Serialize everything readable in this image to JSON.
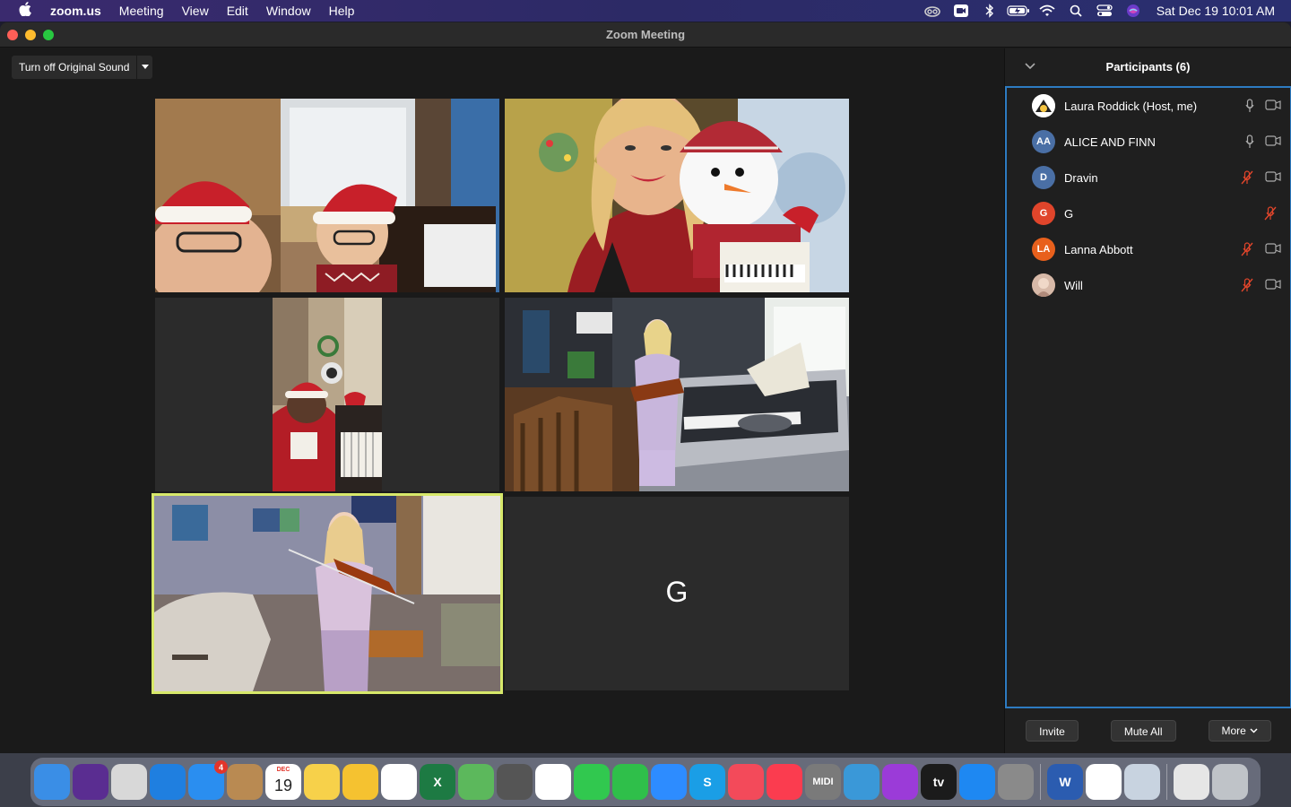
{
  "menubar": {
    "apple_icon": "apple-logo",
    "app_name": "zoom.us",
    "menus": [
      "Meeting",
      "View",
      "Edit",
      "Window",
      "Help"
    ],
    "clock": "Sat Dec 19  10:01 AM",
    "status_icons": [
      "creative-cloud-icon",
      "zoom-icon",
      "bluetooth-icon",
      "battery-icon",
      "wifi-icon",
      "spotlight-icon",
      "control-center-icon",
      "siri-icon"
    ]
  },
  "window": {
    "title": "Zoom Meeting"
  },
  "meeting": {
    "original_sound_label": "Turn off Original Sound",
    "tiles": [
      {
        "participant": "Laura Roddick",
        "active_speaker": false
      },
      {
        "participant": "ALICE AND FINN",
        "active_speaker": false
      },
      {
        "participant": "Dravin",
        "active_speaker": false
      },
      {
        "participant": "Lanna Abbott",
        "active_speaker": false
      },
      {
        "participant": "Will",
        "active_speaker": true
      },
      {
        "participant": "G",
        "active_speaker": false,
        "placeholder_text": "G"
      }
    ],
    "active_speaker_color": "#d7e86a"
  },
  "participants": {
    "header": "Participants (6)",
    "list": [
      {
        "name": "Laura Roddick (Host, me)",
        "initials": "",
        "avatar_color": "#ffffff",
        "mic": "on",
        "video": "on"
      },
      {
        "name": "ALICE AND FINN",
        "initials": "AA",
        "avatar_color": "#4a6fa5",
        "mic": "on",
        "video": "on"
      },
      {
        "name": "Dravin",
        "initials": "D",
        "avatar_color": "#4a6fa5",
        "mic": "muted",
        "video": "on"
      },
      {
        "name": "G",
        "initials": "G",
        "avatar_color": "#e0452b",
        "mic": "muted",
        "video": "none"
      },
      {
        "name": "Lanna Abbott",
        "initials": "LA",
        "avatar_color": "#e8601c",
        "mic": "muted",
        "video": "on"
      },
      {
        "name": "Will",
        "initials": "",
        "avatar_color": "#c9a08a",
        "mic": "muted",
        "video": "on"
      }
    ],
    "buttons": {
      "invite": "Invite",
      "mute_all": "Mute All",
      "more": "More"
    },
    "highlight_color": "#2d7bc1",
    "muted_color": "#e0452b"
  },
  "dock": {
    "apps": [
      {
        "name": "finder-icon",
        "color": "#3a8ee6"
      },
      {
        "name": "siri-icon",
        "color": "#5a2d91"
      },
      {
        "name": "launchpad-icon",
        "color": "#d8d8d8"
      },
      {
        "name": "safari-icon",
        "color": "#1f7fe0"
      },
      {
        "name": "mail-icon",
        "color": "#2a8ef0",
        "badge": "4"
      },
      {
        "name": "contacts-icon",
        "color": "#b98a52"
      },
      {
        "name": "calendar-icon",
        "color": "#ffffff",
        "month": "DEC",
        "day": "19"
      },
      {
        "name": "notes-icon",
        "color": "#f7d14a"
      },
      {
        "name": "weather-icon",
        "color": "#f5c230"
      },
      {
        "name": "reminders-icon",
        "color": "#ffffff"
      },
      {
        "name": "excel-icon",
        "color": "#1d7a43",
        "letter": "X"
      },
      {
        "name": "maps-icon",
        "color": "#5cb85c"
      },
      {
        "name": "calculator-icon",
        "color": "#555555"
      },
      {
        "name": "photos-icon",
        "color": "#ffffff"
      },
      {
        "name": "messages-icon",
        "color": "#31c84f"
      },
      {
        "name": "facetime-icon",
        "color": "#2fbf4a"
      },
      {
        "name": "zoom-icon",
        "color": "#2d8cff"
      },
      {
        "name": "skype-icon",
        "color": "#1a9ee6",
        "letter": "S"
      },
      {
        "name": "news-icon",
        "color": "#f34a5a"
      },
      {
        "name": "music-icon",
        "color": "#fb3c4f"
      },
      {
        "name": "midi-icon",
        "color": "#7a7a7a",
        "letter": "MIDI"
      },
      {
        "name": "simplenote-icon",
        "color": "#3a98d8"
      },
      {
        "name": "podcasts-icon",
        "color": "#9b3bd8"
      },
      {
        "name": "appletv-icon",
        "color": "#1b1b1b",
        "letter": "tv"
      },
      {
        "name": "appstore-icon",
        "color": "#1e88f2"
      },
      {
        "name": "system-preferences-icon",
        "color": "#8a8a8a"
      },
      {
        "name": "word-icon",
        "color": "#2b5cb0",
        "letter": "W"
      },
      {
        "name": "chrome-icon",
        "color": "#ffffff"
      },
      {
        "name": "preview-icon",
        "color": "#c8d3e0"
      },
      {
        "name": "documents-icon",
        "color": "#e6e6e6"
      },
      {
        "name": "trash-icon",
        "color": "#bfc3c8"
      }
    ]
  }
}
